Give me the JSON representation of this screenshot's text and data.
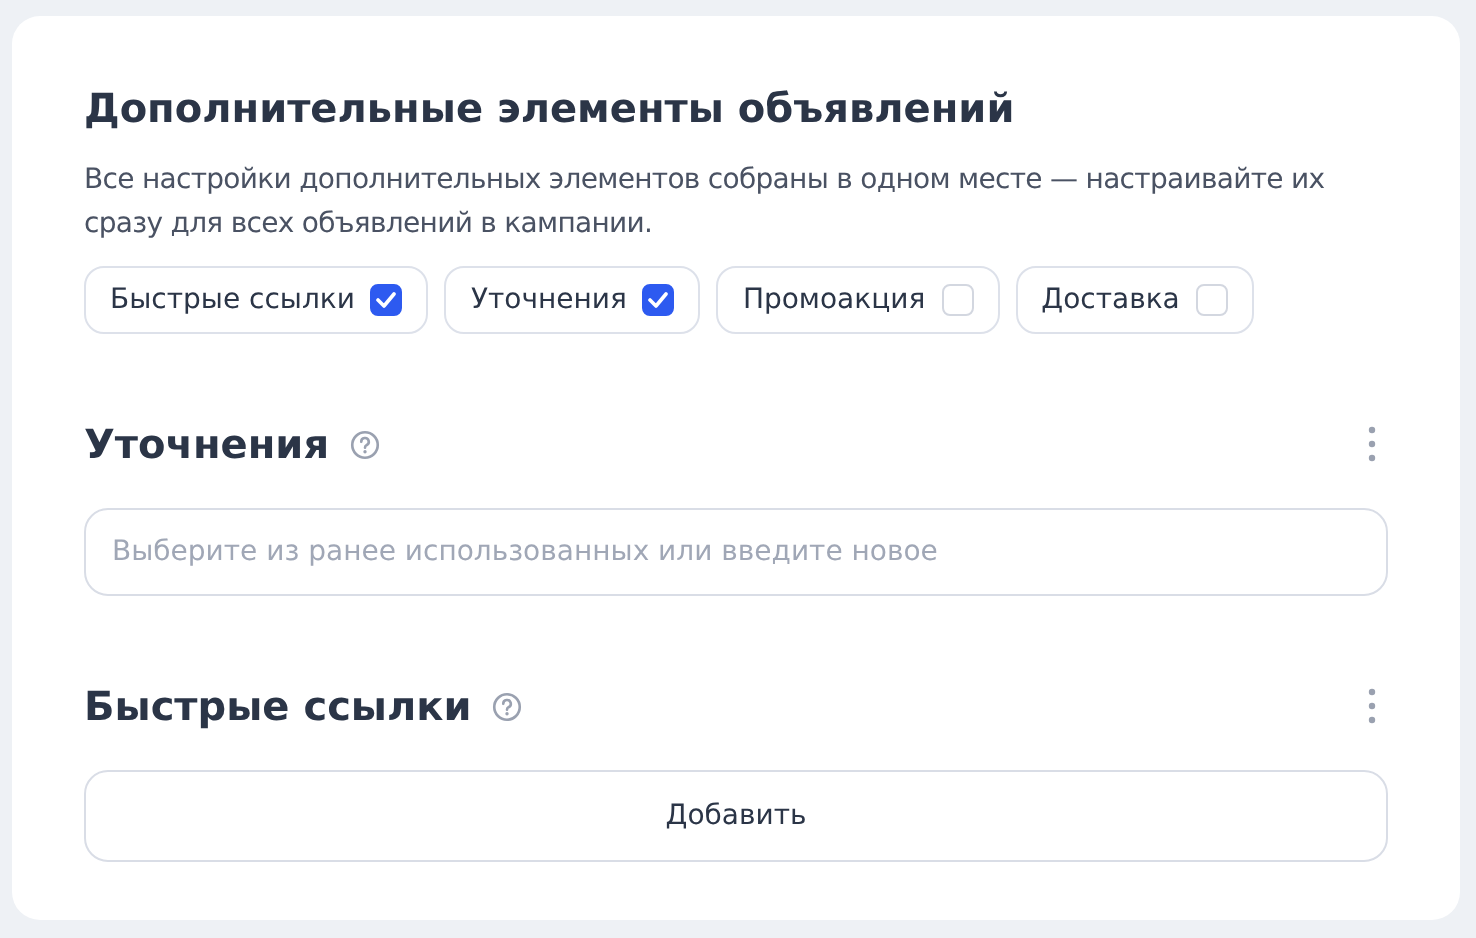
{
  "title": "Дополнительные элементы объявлений",
  "description": "Все настройки дополнительных элементов собраны в одном месте — настраивайте их сразу для всех объявлений в кампании.",
  "toggles": [
    {
      "label": "Быстрые ссылки",
      "checked": true
    },
    {
      "label": "Уточнения",
      "checked": true
    },
    {
      "label": "Промоакция",
      "checked": false
    },
    {
      "label": "Доставка",
      "checked": false
    }
  ],
  "sections": [
    {
      "title": "Уточнения",
      "kind": "field",
      "placeholder": "Выберите из ранее использованных или введите новое"
    },
    {
      "title": "Быстрые ссылки",
      "kind": "button",
      "button": "Добавить"
    }
  ]
}
